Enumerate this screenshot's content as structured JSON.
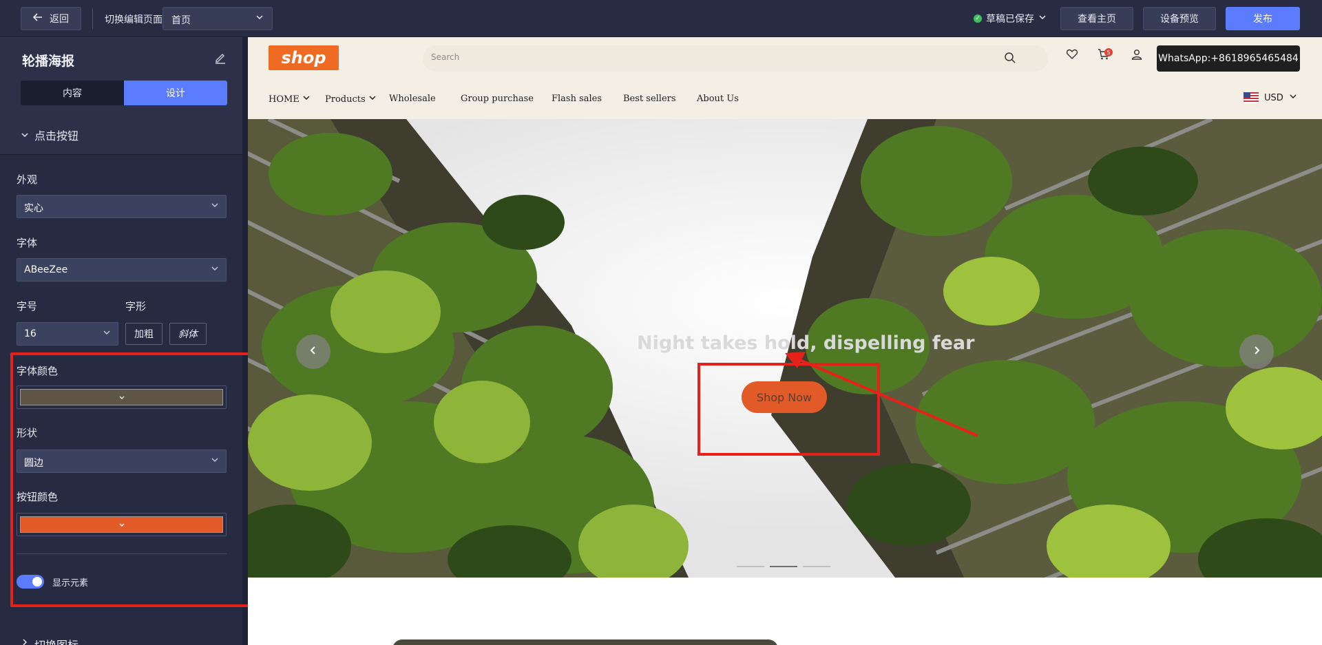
{
  "topbar": {
    "back_label": "返回",
    "switch_page_label": "切换编辑页面",
    "page_select_value": "首页",
    "draft_status": "草稿已保存",
    "view_home_label": "查看主页",
    "device_preview_label": "设备预览",
    "publish_label": "发布"
  },
  "panel": {
    "title": "轮播海报",
    "tabs": [
      {
        "label": "内容",
        "active": false
      },
      {
        "label": "设计",
        "active": true
      }
    ],
    "section_label": "点击按钮",
    "appearance_label": "外观",
    "appearance_value": "实心",
    "font_label": "字体",
    "font_value": "ABeeZee",
    "font_size_label": "字号",
    "font_size_value": "16",
    "font_style_label": "字形",
    "bold_label": "加粗",
    "italic_label": "斜体",
    "font_color_label": "字体颜色",
    "font_color": "#5e5545",
    "shape_label": "形状",
    "shape_value": "圆边",
    "button_color_label": "按钮颜色",
    "button_color": "#e25a28",
    "show_element_label": "显示元素",
    "show_element_on": true,
    "next_section_label": "切换图标"
  },
  "site": {
    "logo_text": "shop",
    "search_placeholder": "Search",
    "cart_count": "5",
    "whatsapp_label": "WhatsApp:+8618965465484",
    "nav": [
      "HOME",
      "Products",
      "Wholesale",
      "Group purchase",
      "Flash sales",
      "Best sellers",
      "About Us"
    ],
    "currency": "USD",
    "hero_text": "Night takes hold, dispelling fear",
    "hero_button_label": "Shop Now",
    "slide_count": 3,
    "active_slide": 2
  },
  "colors": {
    "accent": "#5b7cff",
    "brand_orange": "#ef6a22",
    "annotation_red": "#e8201a"
  }
}
